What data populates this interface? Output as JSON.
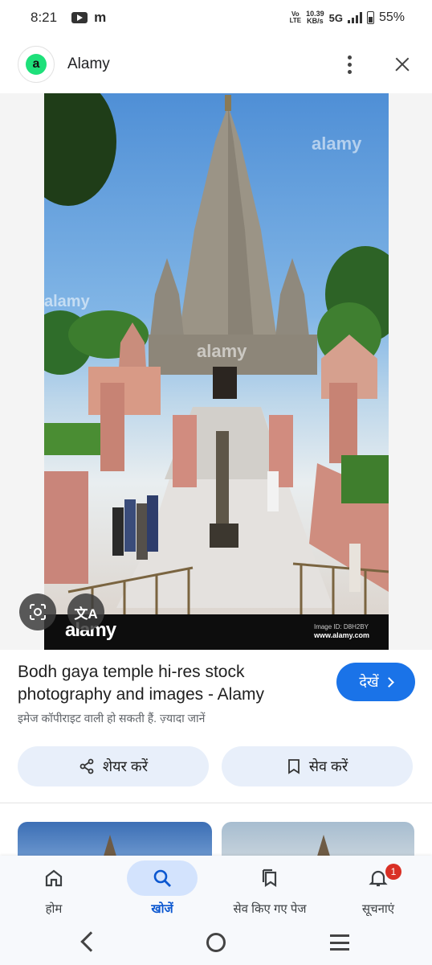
{
  "status_bar": {
    "time": "8:21",
    "volte": "VoLTE",
    "speed_value": "10.39",
    "speed_unit": "KB/s",
    "network": "5G",
    "battery": "55%"
  },
  "header": {
    "logo_letter": "a",
    "site_name": "Alamy"
  },
  "image": {
    "watermark": "alamy",
    "footer_brand": "alamy",
    "image_id": "Image ID: D8H2BY",
    "image_site": "www.alamy.com",
    "translate_glyph": "文A"
  },
  "result": {
    "title": "Bodh gaya temple hi-res stock photography and images - Alamy",
    "copyright_note": "इमेज कॉपीराइट वाली हो सकती हैं. ज़्यादा जानें",
    "visit_label": "देखें",
    "share_label": "शेयर करें",
    "save_label": "सेव करें"
  },
  "bottom_nav": {
    "home": "होम",
    "search": "खोजें",
    "saved": "सेव किए गए पेज",
    "notifications": "सूचनाएं",
    "notification_count": "1"
  },
  "colors": {
    "accent": "#1a73e8",
    "pill_bg": "#e8effa",
    "active_nav": "#d3e3fd"
  }
}
